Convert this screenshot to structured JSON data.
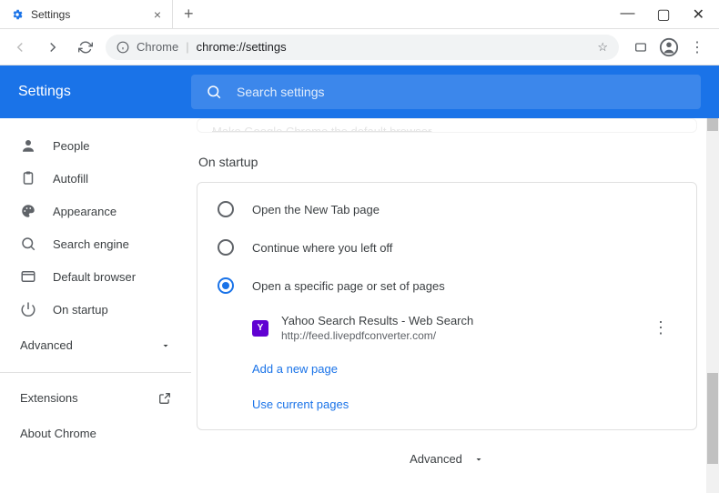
{
  "window": {
    "tab_title": "Settings",
    "minimize": "—",
    "maximize": "▢",
    "close": "✕"
  },
  "address": {
    "scheme_label": "Chrome",
    "url": "chrome://settings"
  },
  "header": {
    "title": "Settings",
    "search_placeholder": "Search settings"
  },
  "sidebar": {
    "items": [
      {
        "id": "people",
        "label": "People"
      },
      {
        "id": "autofill",
        "label": "Autofill"
      },
      {
        "id": "appearance",
        "label": "Appearance"
      },
      {
        "id": "search",
        "label": "Search engine"
      },
      {
        "id": "default",
        "label": "Default browser"
      },
      {
        "id": "startup",
        "label": "On startup"
      }
    ],
    "advanced": "Advanced",
    "extensions": "Extensions",
    "about": "About Chrome"
  },
  "main": {
    "banner": "Make Google Chrome the default browser",
    "section_title": "On startup",
    "options": [
      {
        "label": "Open the New Tab page",
        "selected": false
      },
      {
        "label": "Continue where you left off",
        "selected": false
      },
      {
        "label": "Open a specific page or set of pages",
        "selected": true
      }
    ],
    "page": {
      "favicon_letter": "Y",
      "title": "Yahoo Search Results - Web Search",
      "url": "http://feed.livepdfconverter.com/"
    },
    "add_page": "Add a new page",
    "use_current": "Use current pages",
    "advanced_footer": "Advanced"
  }
}
